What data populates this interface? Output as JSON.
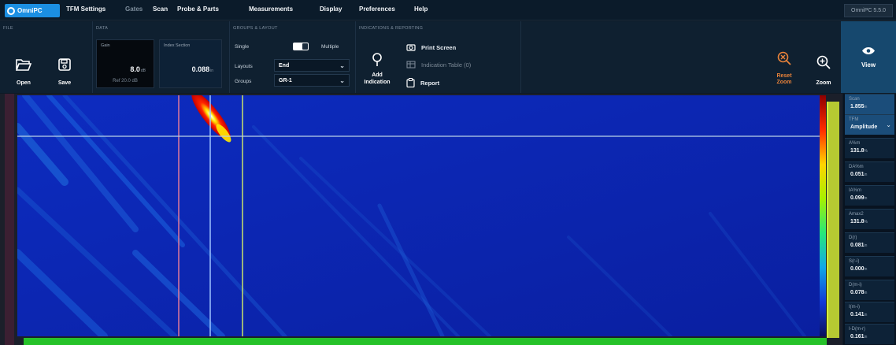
{
  "menubar": {
    "brand": "OmniPC",
    "items": [
      "TFM Settings",
      "Gates",
      "Scan",
      "Probe & Parts",
      "Measurements",
      "Display",
      "Preferences",
      "Help"
    ],
    "version": "OmniPC 5.5.0"
  },
  "ribbon": {
    "file": {
      "header": "FILE",
      "open": "Open",
      "save": "Save"
    },
    "data": {
      "header": "DATA",
      "gain_title": "Gain",
      "gain_value": "8.0",
      "gain_unit": "dB",
      "gain_ref": "Ref 20.0 dB",
      "index_title": "Index Section",
      "index_value": "0.088",
      "index_unit": "in"
    },
    "groups": {
      "header": "GROUPS & LAYOUT",
      "single": "Single",
      "multiple": "Multiple",
      "layouts_label": "Layouts",
      "layouts_value": "End",
      "groups_label": "Groups",
      "groups_value": "GR-1"
    },
    "indications": {
      "header": "INDICATIONS & REPORTING",
      "add_line1": "Add",
      "add_line2": "Indication",
      "print": "Print Screen",
      "table": "Indication Table (0)",
      "report": "Report"
    },
    "zoom": {
      "reset_line1": "Reset",
      "reset_line2": "Zoom",
      "zoom": "Zoom"
    },
    "view": "View"
  },
  "readings": [
    {
      "name": "Scan",
      "value": "1.855",
      "unit": "in",
      "highlight": true
    },
    {
      "name": "TFM",
      "value": "Amplitude",
      "unit": "",
      "highlight": true,
      "dropdown": true
    },
    {
      "name": "A%m",
      "value": "131.8",
      "unit": "%"
    },
    {
      "name": "DA%m",
      "value": "0.051",
      "unit": "in"
    },
    {
      "name": "IA%m",
      "value": "0.099",
      "unit": "in"
    },
    {
      "name": "Amax2",
      "value": "131.8",
      "unit": "%"
    },
    {
      "name": "D(r)",
      "value": "0.081",
      "unit": "in"
    },
    {
      "name": "S(r-i)",
      "value": "0.000",
      "unit": "in"
    },
    {
      "name": "D(m-i)",
      "value": "0.078",
      "unit": "in"
    },
    {
      "name": "I(m-i)",
      "value": "0.141",
      "unit": "in"
    },
    {
      "name": "I-D(m-r)",
      "value": "0.161",
      "unit": "in"
    }
  ],
  "colors": {
    "accent": "#1b8fe2",
    "highlight_zoom": "#e8823a",
    "plot_bg": "#0b1f9a"
  }
}
